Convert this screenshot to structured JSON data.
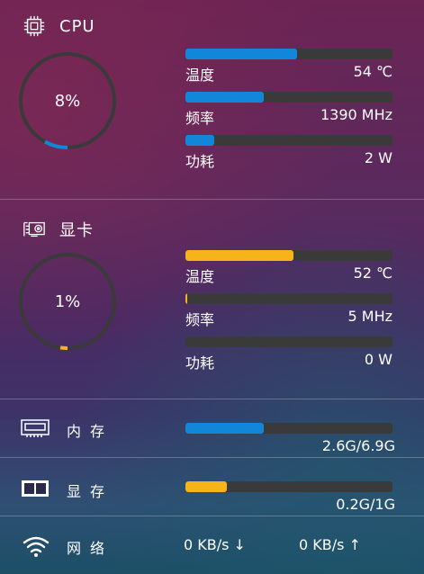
{
  "cpu": {
    "title": "CPU",
    "percent_text": "8%",
    "percent": 8,
    "metrics": [
      {
        "label": "温度",
        "value": "54 ℃",
        "fill": 0.54
      },
      {
        "label": "频率",
        "value": "1390 MHz",
        "fill": 0.38
      },
      {
        "label": "功耗",
        "value": "2 W",
        "fill": 0.14
      }
    ],
    "icon": "cpu-chip-icon"
  },
  "gpu": {
    "title": "显卡",
    "percent_text": "1%",
    "percent": 1,
    "metrics": [
      {
        "label": "温度",
        "value": "52 ℃",
        "fill": 0.52
      },
      {
        "label": "频率",
        "value": "5 MHz",
        "fill": 0.01
      },
      {
        "label": "功耗",
        "value": "0 W",
        "fill": 0.0
      }
    ],
    "icon": "graphics-card-icon"
  },
  "memory": {
    "label": "内存",
    "value": "2.6G/6.9G",
    "fill": 0.38,
    "icon": "memory-module-icon"
  },
  "vram": {
    "label": "显存",
    "value": "0.2G/1G",
    "fill": 0.2,
    "icon": "video-memory-icon"
  },
  "network": {
    "label": "网络",
    "down": "0 KB/s ↓",
    "up": "0 KB/s ↑",
    "icon": "wifi-icon"
  },
  "colors": {
    "blue": "#1287d9",
    "orange": "#f6b41a",
    "track": "#3a3a3a"
  }
}
